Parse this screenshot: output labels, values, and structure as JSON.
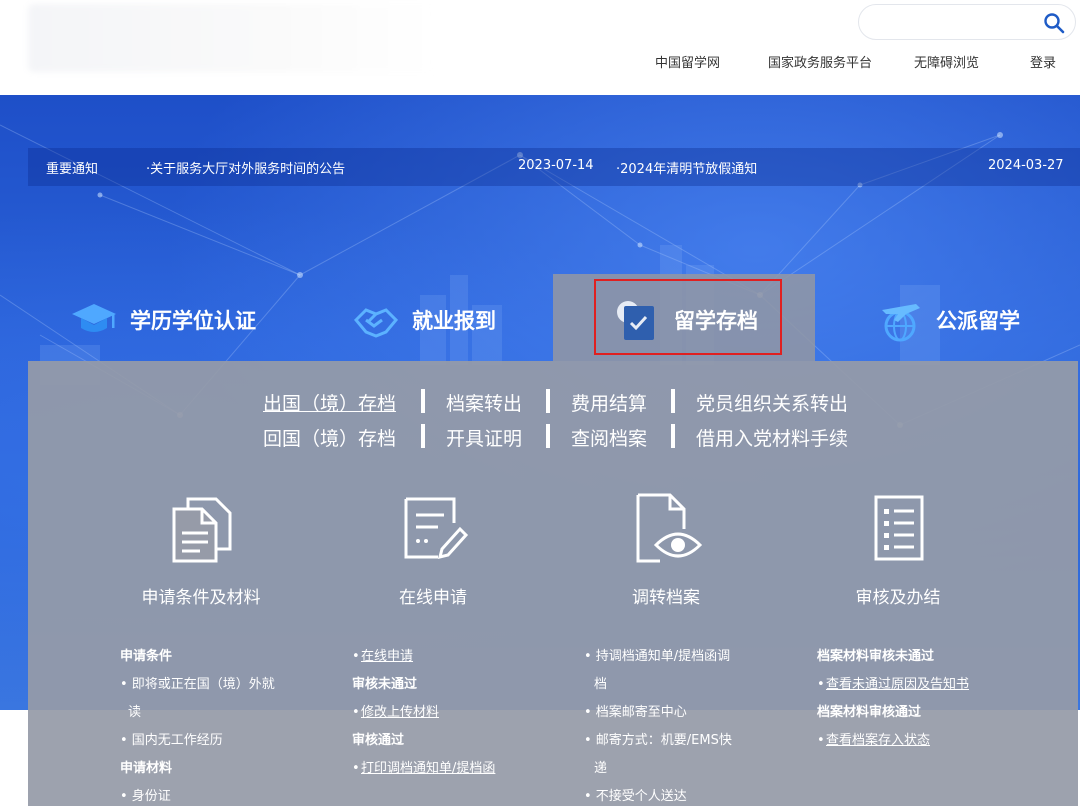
{
  "header": {
    "search": {
      "placeholder": "",
      "value": ""
    },
    "top_links": [
      "中国留学网",
      "国家政务服务平台",
      "无障碍浏览",
      "登录"
    ]
  },
  "notices": {
    "label": "重要通知",
    "items": [
      {
        "title": "·关于服务大厅对外服务时间的公告",
        "date": "2023-07-14"
      },
      {
        "title": "·2024年清明节放假通知",
        "date": "2024-03-27"
      }
    ]
  },
  "tabs": [
    {
      "label": "学历学位认证",
      "icon": "graduation-cap-icon"
    },
    {
      "label": "就业报到",
      "icon": "handshake-icon"
    },
    {
      "label": "留学存档",
      "icon": "archive-icon",
      "active": true
    },
    {
      "label": "公派留学",
      "icon": "plane-globe-icon"
    }
  ],
  "sub_links": {
    "row1": [
      "出国（境）存档",
      "档案转出",
      "费用结算",
      "党员组织关系转出"
    ],
    "row2": [
      "回国（境）存档",
      "开具证明",
      "查阅档案",
      "借用入党材料手续"
    ]
  },
  "steps": [
    {
      "label": "申请条件及材料",
      "icon": "documents-icon"
    },
    {
      "label": "在线申请",
      "icon": "form-edit-icon"
    },
    {
      "label": "调转档案",
      "icon": "file-view-icon"
    },
    {
      "label": "审核及办结",
      "icon": "checklist-icon"
    }
  ],
  "columns": {
    "col1": {
      "conditions_heading": "申请条件",
      "cond1_line1": "• 即将或正在国（境）外就",
      "cond1_line2": "读",
      "cond2": "• 国内无工作经历",
      "materials_heading": "申请材料",
      "mat1": "• 身份证"
    },
    "col2": {
      "online_apply": "在线申请",
      "not_passed_heading": "审核未通过",
      "modify_upload": "修改上传材料",
      "passed_heading": "审核通过",
      "print_notice": "打印调档通知单/提档函"
    },
    "col3": {
      "item1_line1": "• 持调档通知单/提档函调",
      "item1_line2": "档",
      "item2": "• 档案邮寄至中心",
      "item3_line1": "• 邮寄方式：机要/EMS快",
      "item3_line2": "递",
      "item4": "• 不接受个人送达"
    },
    "col4": {
      "not_passed_heading": "档案材料审核未通过",
      "view_reason": "查看未通过原因及告知书",
      "passed_heading": "档案材料审核通过",
      "view_status": "查看档案存入状态"
    }
  }
}
